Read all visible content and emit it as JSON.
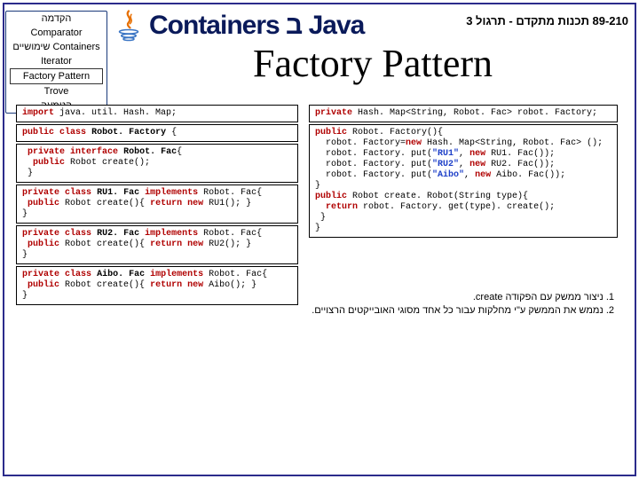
{
  "outline": {
    "items": [
      "הקדמה",
      "Comparator",
      "שימושיים Containers",
      "Iterator",
      "Factory Pattern",
      "Trove",
      "הטמעה"
    ],
    "active_index": 4
  },
  "header": {
    "wordart": "Containers ב Java",
    "course": "89-210 תכנות מתקדם - תרגול 3"
  },
  "slide": {
    "title": "Factory Pattern"
  },
  "code": {
    "left": [
      "import java. util. Hash. Map;",
      "public class Robot. Factory {",
      " private interface Robot. Fac{\n  public Robot create();\n }",
      "private class RU1. Fac implements Robot. Fac{\n public Robot create(){ return new RU1(); }\n}",
      "private class RU2. Fac implements Robot. Fac{\n public Robot create(){ return new RU2(); }\n}",
      "private class Aibo. Fac implements Robot. Fac{\n public Robot create(){ return new Aibo(); }\n}"
    ],
    "right": [
      "private Hash. Map<String, Robot. Fac> robot. Factory;",
      "public Robot. Factory(){\n  robot. Factory=new Hash. Map<String, Robot. Fac> ();\n  robot. Factory. put(\"RU1\", new RU1. Fac());\n  robot. Factory. put(\"RU2\", new RU2. Fac());\n  robot. Factory. put(\"Aibo\", new Aibo. Fac());\n}\npublic Robot create. Robot(String type){\n  return robot. Factory. get(type). create();\n }\n}"
    ]
  },
  "notes": {
    "line1_num": "1.",
    "line1_pre": "ניצור ממשק עם הפקודה ",
    "line1_code": "create",
    "line1_post": ".",
    "line2_num": "2.",
    "line2": "נממש את הממשק ע\"י מחלקות עבור כל אחד מסוגי האובייקטים הרצויים."
  }
}
